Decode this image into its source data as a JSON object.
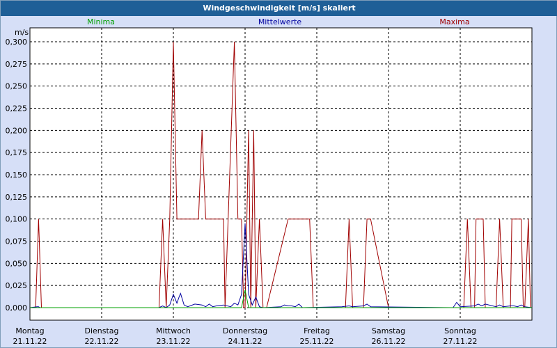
{
  "window": {
    "title": "Windgeschwindigkeit [m/s] skaliert"
  },
  "legend": {
    "min": "Minima",
    "avg": "Mittelwerte",
    "max": "Maxima"
  },
  "colors": {
    "min": "#00a000",
    "avg": "#0000a0",
    "max": "#a00000",
    "plot_bg": "#ffffff",
    "grid": "#000000"
  },
  "chart_data": {
    "type": "line",
    "title": "Windgeschwindigkeit [m/s] skaliert",
    "ylabel": "m/s",
    "xlabel": "",
    "ylim": [
      0,
      0.3
    ],
    "yticks": [
      "0,000",
      "0,025",
      "0,050",
      "0,075",
      "0,100",
      "0,125",
      "0,150",
      "0,175",
      "0,200",
      "0,225",
      "0,250",
      "0,275",
      "0,300"
    ],
    "xlim": [
      0,
      7
    ],
    "x_ticks": [
      {
        "day": "Montag",
        "date": "21.11.22"
      },
      {
        "day": "Dienstag",
        "date": "22.11.22"
      },
      {
        "day": "Mittwoch",
        "date": "23.11.22"
      },
      {
        "day": "Donnerstag",
        "date": "24.11.22"
      },
      {
        "day": "Freitag",
        "date": "25.11.22"
      },
      {
        "day": "Samstag",
        "date": "26.11.22"
      },
      {
        "day": "Sonntag",
        "date": "27.11.22"
      }
    ],
    "grid": true,
    "series": [
      {
        "name": "Maxima",
        "x": [
          0,
          0.08,
          0.12,
          0.16,
          0.2,
          1.8,
          1.85,
          1.9,
          1.95,
          2.0,
          2.05,
          2.1,
          2.15,
          2.2,
          2.35,
          2.4,
          2.45,
          2.5,
          2.55,
          2.6,
          2.7,
          2.72,
          2.85,
          2.9,
          2.95,
          2.98,
          3.0,
          3.05,
          3.08,
          3.12,
          3.15,
          3.2,
          3.25,
          3.3,
          3.6,
          3.65,
          3.75,
          3.9,
          3.95,
          4.4,
          4.45,
          4.5,
          4.65,
          4.7,
          4.75,
          5.0,
          5.1,
          5.2,
          5.3,
          6.05,
          6.1,
          6.15,
          6.2,
          6.22,
          6.28,
          6.32,
          6.35,
          6.5,
          6.55,
          6.6,
          6.7,
          6.72,
          6.85,
          6.88,
          6.9,
          6.95,
          6.98,
          7.0
        ],
        "values": [
          0,
          0,
          0.1,
          0,
          0,
          0,
          0.1,
          0,
          0.1,
          0.3,
          0.1,
          0.1,
          0.1,
          0.1,
          0.1,
          0.2,
          0.1,
          0.1,
          0.1,
          0.1,
          0.1,
          0,
          0.3,
          0.1,
          0.1,
          0,
          0,
          0.2,
          0,
          0.2,
          0,
          0.1,
          0,
          0,
          0.1,
          0.1,
          0.1,
          0.1,
          0,
          0,
          0.1,
          0,
          0,
          0.1,
          0.1,
          0,
          0,
          0,
          0,
          0,
          0.1,
          0,
          0,
          0.1,
          0.1,
          0.1,
          0,
          0,
          0.1,
          0,
          0,
          0.1,
          0.1,
          0,
          0,
          0.1,
          0,
          0
        ],
        "color": "#a00000"
      },
      {
        "name": "Mittelwerte",
        "x": [
          0,
          0.1,
          0.12,
          0.14,
          1.8,
          1.85,
          1.9,
          1.95,
          2.0,
          2.05,
          2.08,
          2.1,
          2.15,
          2.2,
          2.3,
          2.4,
          2.45,
          2.5,
          2.55,
          2.6,
          2.7,
          2.8,
          2.85,
          2.9,
          2.95,
          3.0,
          3.05,
          3.1,
          3.15,
          3.2,
          3.25,
          3.5,
          3.55,
          3.6,
          3.65,
          3.7,
          3.75,
          3.8,
          4.35,
          4.45,
          4.5,
          4.65,
          4.7,
          4.75,
          5.9,
          5.95,
          6.0,
          6.2,
          6.25,
          6.3,
          6.35,
          6.5,
          6.55,
          6.6,
          6.7,
          6.75,
          6.8,
          6.85,
          6.9,
          7.0
        ],
        "values": [
          0,
          0.001,
          0.001,
          0,
          0,
          0.002,
          0,
          0.003,
          0.015,
          0.005,
          0.012,
          0.016,
          0.003,
          0.001,
          0.004,
          0.003,
          0.001,
          0.004,
          0.001,
          0.002,
          0.003,
          0.001,
          0.005,
          0.003,
          0.015,
          0.095,
          0.015,
          0.003,
          0.012,
          0.001,
          0,
          0.001,
          0.003,
          0.002,
          0.002,
          0.001,
          0.004,
          0,
          0.001,
          0.002,
          0.001,
          0.002,
          0.004,
          0.001,
          0,
          0.006,
          0.001,
          0.002,
          0.004,
          0.002,
          0.004,
          0.001,
          0.003,
          0.001,
          0.002,
          0.002,
          0.001,
          0.003,
          0.001,
          0
        ],
        "color": "#0000a0"
      },
      {
        "name": "Minima",
        "x": [
          0,
          2.95,
          3.0,
          3.05,
          7.0
        ],
        "values": [
          0,
          0,
          0.02,
          0,
          0
        ],
        "color": "#00a000"
      }
    ]
  }
}
